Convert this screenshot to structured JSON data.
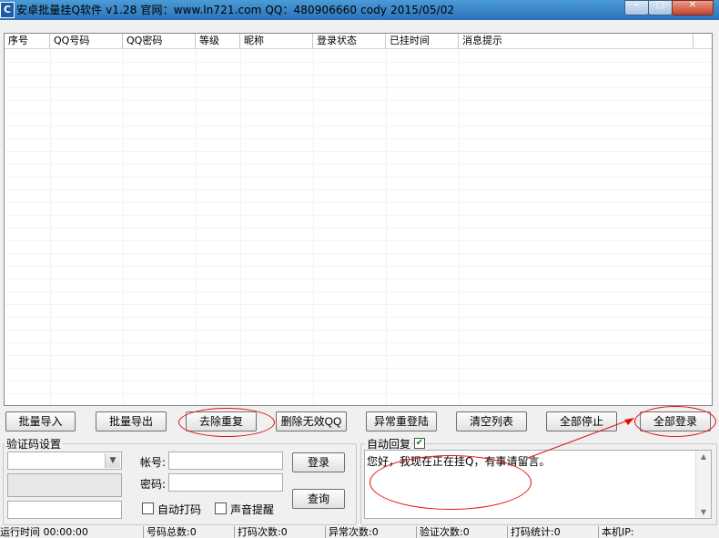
{
  "window": {
    "title": "安卓批量挂Q软件 v1.28  官网：www.ln721.com  QQ：480906660    cody  2015/05/02",
    "icon_text": "C"
  },
  "list": {
    "columns": [
      "序号",
      "QQ号码",
      "QQ密码",
      "等级",
      "昵称",
      "登录状态",
      "已挂时间",
      "消息提示"
    ]
  },
  "toolbar": {
    "import": "批量导入",
    "export": "批量导出",
    "dedupe": "去除重复",
    "delete_invalid": "删除无效QQ",
    "relogin": "异常重登陆",
    "clear": "清空列表",
    "stop_all": "全部停止",
    "login_all": "全部登录"
  },
  "captcha": {
    "group_title": "验证码设置",
    "account_label": "帐号:",
    "password_label": "密码:",
    "login": "登录",
    "query": "查询",
    "auto_code": "自动打码",
    "sound_alert": "声音提醒"
  },
  "reply": {
    "group_title": "自动回复",
    "enabled": true,
    "message": "您好，我现在正在挂Q，有事请留言。"
  },
  "statusbar": {
    "runtime": "运行时间 00:00:00",
    "total": "号码总数:0",
    "code_count": "打码次数:0",
    "error_count": "异常次数:0",
    "verify_count": "验证次数:0",
    "code_stats": "打码统计:0",
    "local_ip": "本机IP:"
  },
  "colors": {
    "titlebar": "#2c72b9",
    "annotation": "#e01010"
  }
}
